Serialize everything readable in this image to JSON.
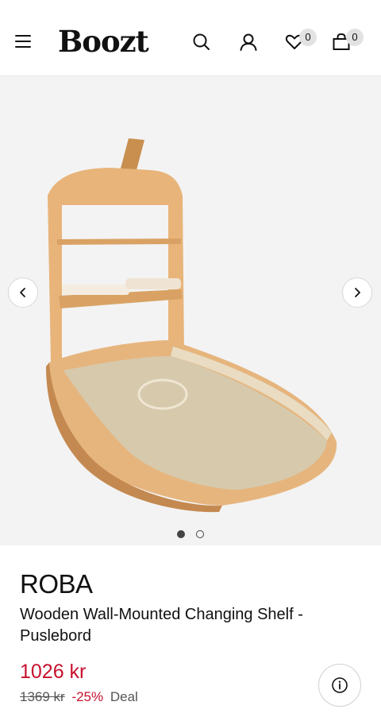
{
  "header": {
    "logo": "Boozt",
    "wishlist_count": "0",
    "cart_count": "0",
    "icons": [
      "menu-icon",
      "search-icon",
      "user-icon",
      "heart-icon",
      "bag-icon"
    ]
  },
  "gallery": {
    "image_alt": "Wooden Wall-Mounted Changing Shelf",
    "slide_count": 2,
    "active_slide": 1,
    "prev_icon": "chevron-left-icon",
    "next_icon": "chevron-right-icon"
  },
  "product": {
    "brand": "ROBA",
    "title": "Wooden Wall-Mounted Changing Shelf - Puslebord",
    "price": "1026 kr",
    "old_price": "1369 kr",
    "discount": "-25%",
    "deal_label": "Deal"
  },
  "colors": {
    "sale_red": "#c8102e",
    "gallery_bg": "#f3f3f3"
  }
}
